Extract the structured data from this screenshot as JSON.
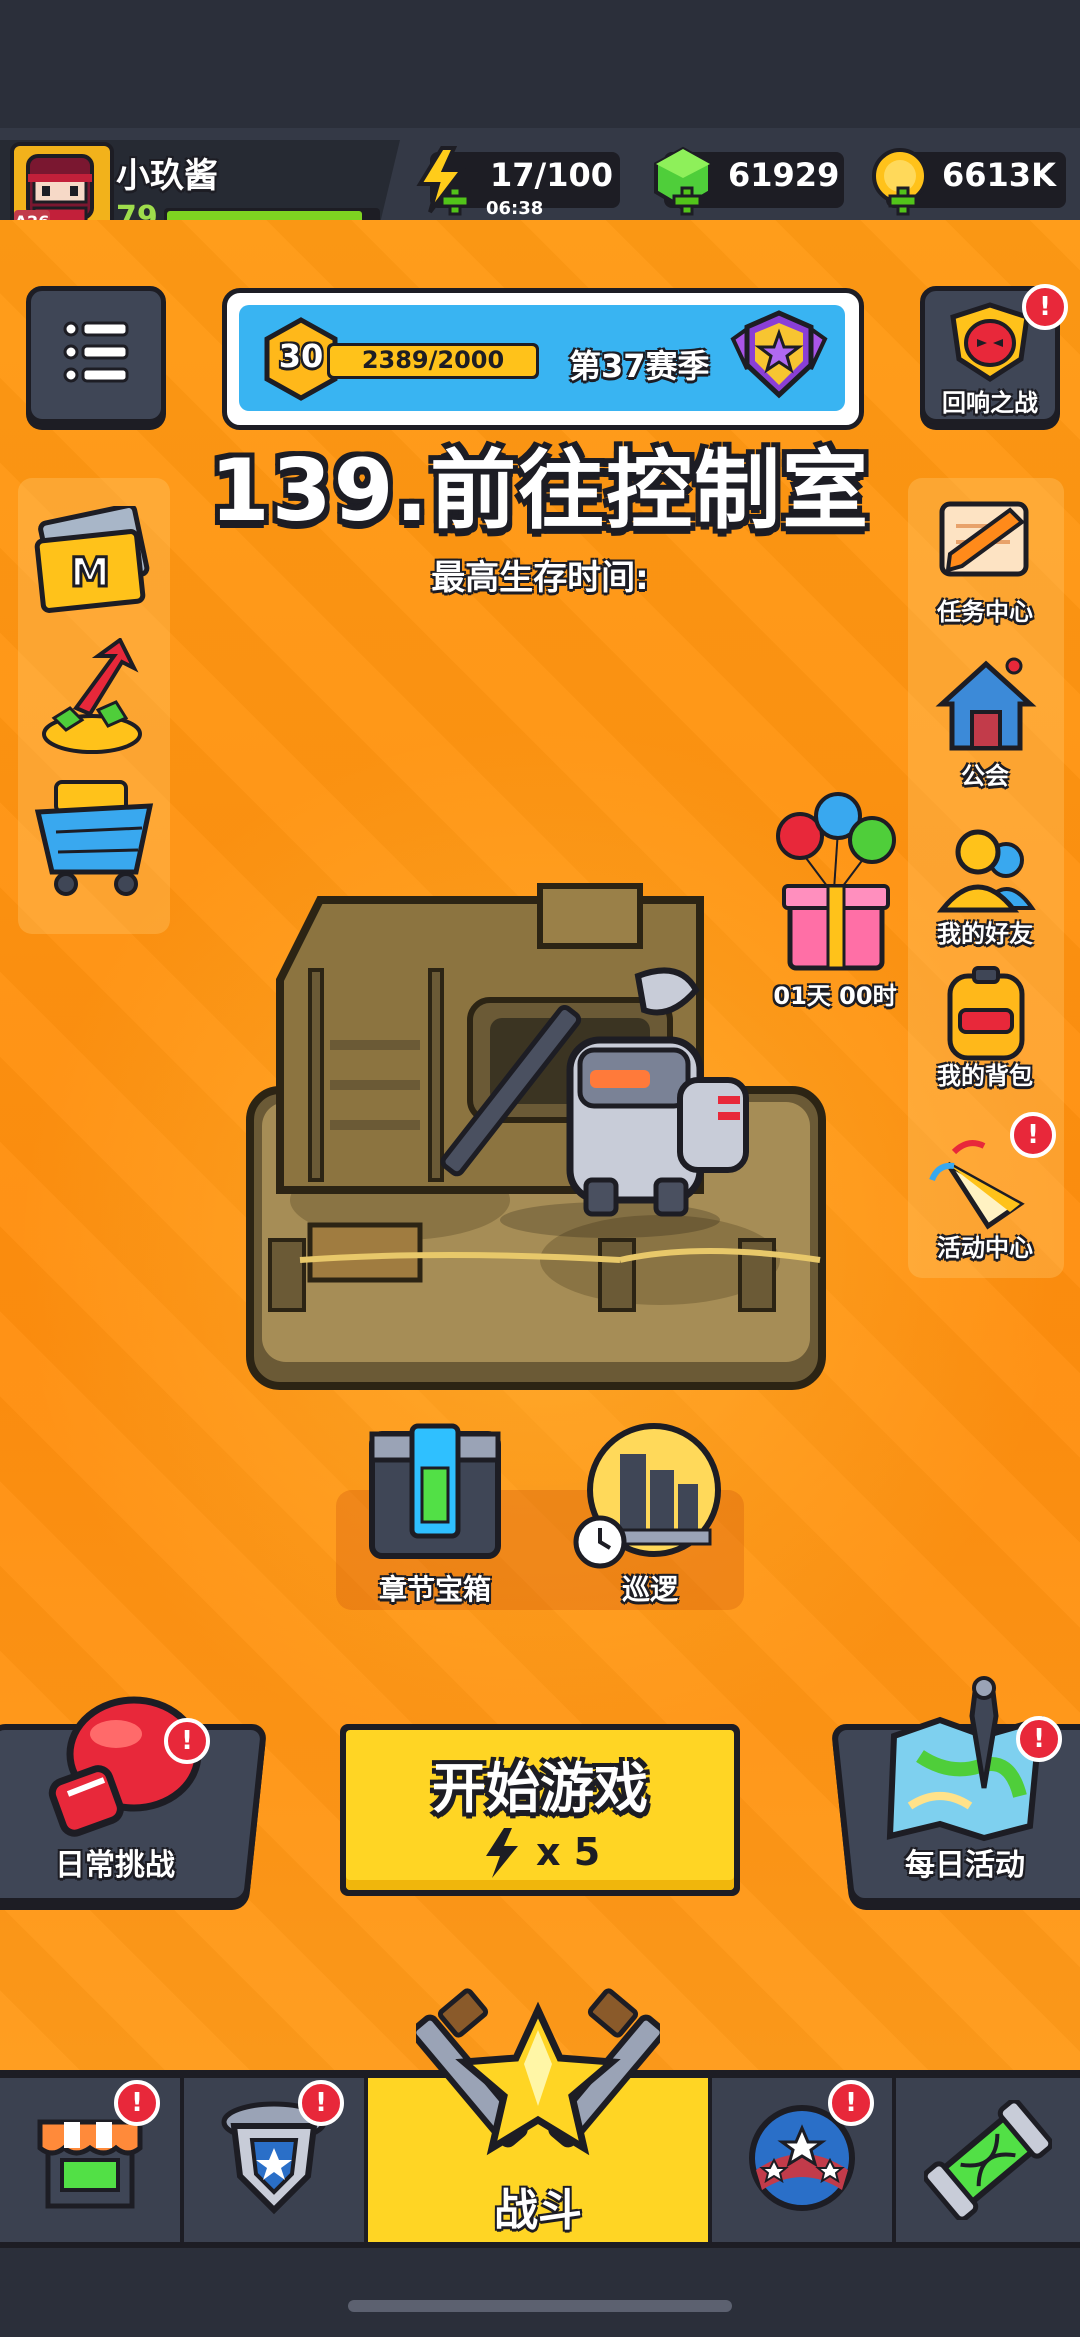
{
  "player": {
    "name": "小玖酱",
    "level": "79",
    "avatar_tag": "A26",
    "xp_fraction": 0.93
  },
  "currencies": {
    "energy": {
      "value": "17/100",
      "timer": "06:38"
    },
    "gems": {
      "value": "61929"
    },
    "coins": {
      "value": "6613K"
    }
  },
  "season": {
    "level": "30",
    "progress": "2389/2000",
    "label": "第37赛季",
    "progress_fraction": 1.0
  },
  "echo_battle": {
    "label": "回响之战"
  },
  "chapter": {
    "title": "139.前往控制室",
    "subtitle": "最高生存时间:"
  },
  "right_menu": {
    "task_center": "任务中心",
    "guild": "公会",
    "friends": "我的好友",
    "backpack": "我的背包",
    "events": "活动中心"
  },
  "gift": {
    "timer": "01天 00时"
  },
  "chapter_chest": {
    "label": "章节宝箱"
  },
  "patrol": {
    "label": "巡逻"
  },
  "daily_challenge": {
    "label": "日常挑战"
  },
  "start": {
    "label": "开始游戏",
    "cost": "x 5"
  },
  "daily_activity": {
    "label": "每日活动"
  },
  "bottom_nav": {
    "battle": "战斗"
  },
  "colors": {
    "accent_orange": "#ff9214",
    "start_yellow": "#ffd524",
    "badge_red": "#e8283a",
    "xp_green": "#7ed321"
  }
}
